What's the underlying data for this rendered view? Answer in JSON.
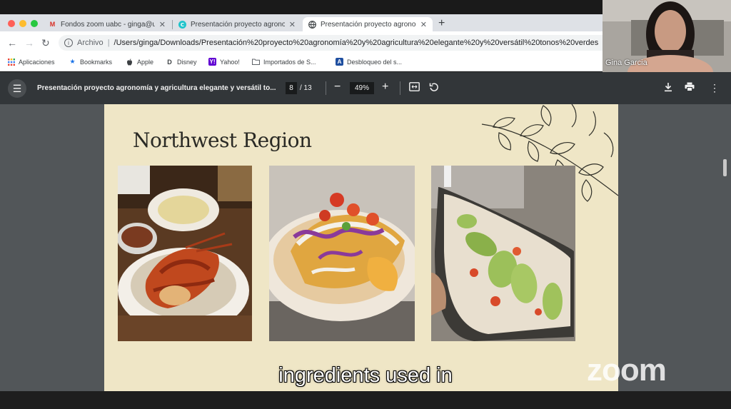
{
  "browser": {
    "tabs": [
      {
        "label": "Fondos zoom uabc - ginga@u",
        "favicon": "gmail-icon"
      },
      {
        "label": "Presentación proyecto agronomía",
        "favicon": "canva-icon"
      },
      {
        "label": "Presentación proyecto agronomía",
        "favicon": "globe-icon",
        "active": true
      }
    ],
    "address": {
      "scheme_label": "Archivo",
      "url": "/Users/ginga/Downloads/Presentación%20proyecto%20agronomía%20y%20agricultura%20elegante%20y%20versátil%20tonos%20verdes"
    },
    "bookmarks": [
      {
        "label": "Aplicaciones",
        "icon": "apps-grid-icon"
      },
      {
        "label": "Bookmarks",
        "icon": "star-icon"
      },
      {
        "label": "Apple",
        "icon": "apple-icon"
      },
      {
        "label": "Disney",
        "icon": "disney-icon"
      },
      {
        "label": "Yahoo!",
        "icon": "yahoo-icon"
      },
      {
        "label": "Importados de S...",
        "icon": "folder-icon"
      },
      {
        "label": "Desbloqueo del s...",
        "icon": "a-icon"
      }
    ]
  },
  "pdf_viewer": {
    "title": "Presentación proyecto agronomía y agricultura elegante y versátil to...",
    "current_page": "8",
    "page_total": "/ 13",
    "zoom": "49%"
  },
  "slide": {
    "title": "Northwest Region",
    "photos": [
      "lobster-plate-photo",
      "fish-taco-photo",
      "tostada-avocado-photo"
    ],
    "background_color": "#efe6c6"
  },
  "video": {
    "participant_name": "Gina Garcia",
    "caption": "ingredients used in",
    "watermark": "zoom"
  }
}
